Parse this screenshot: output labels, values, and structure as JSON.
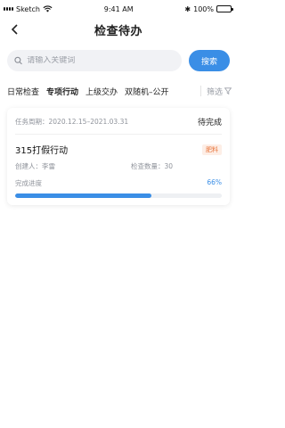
{
  "status_bar": {
    "carrier": "Sketch",
    "time": "9:41 AM",
    "bluetooth": "✱",
    "battery": "100%"
  },
  "nav": {
    "back_icon": "chevron-left-icon",
    "title": "检查待办"
  },
  "search": {
    "placeholder": "请输入关键词",
    "button_label": "搜索"
  },
  "tabs": [
    {
      "label": "日常检查",
      "active": false
    },
    {
      "label": "专项行动",
      "active": true
    },
    {
      "label": "上级交办",
      "active": false
    },
    {
      "label": "双随机–公开",
      "active": false
    }
  ],
  "filter": {
    "label": "筛选",
    "icon": "funnel-icon"
  },
  "task": {
    "period": "任务周期：2020.12.15–2021.03.31",
    "status": "待完成",
    "title": "315打假行动",
    "tag": "肥料",
    "creator": "创建人：李雷",
    "count": "检查数量：30",
    "progress_label": "完成进度",
    "progress_text": "66%",
    "progress_value": 66
  },
  "colors": {
    "accent": "#3a8ee6",
    "tag_text": "#e8743b",
    "tag_bg": "#fdeee6"
  }
}
